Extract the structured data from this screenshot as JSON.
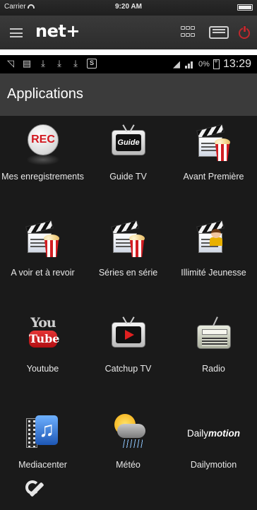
{
  "ios_status": {
    "carrier": "Carrier",
    "time": "9:20 AM"
  },
  "header": {
    "brand": "net+"
  },
  "android_status": {
    "battery_percent": "0%",
    "time": "13:29"
  },
  "screen_title": "Applications",
  "apps": [
    {
      "label": "Mes enregistrements",
      "icon": "rec-icon"
    },
    {
      "label": "Guide TV",
      "icon": "tv-guide-icon"
    },
    {
      "label": "Avant Première",
      "icon": "clapperboard-popcorn-icon"
    },
    {
      "label": "A voir et à revoir",
      "icon": "clapperboard-popcorn-icon"
    },
    {
      "label": "Séries en série",
      "icon": "clapperboard-popcorn-icon"
    },
    {
      "label": "Illimité Jeunesse",
      "icon": "clapperboard-kid-icon"
    },
    {
      "label": "Youtube",
      "icon": "youtube-icon"
    },
    {
      "label": "Catchup TV",
      "icon": "tv-play-icon"
    },
    {
      "label": "Radio",
      "icon": "radio-icon"
    },
    {
      "label": "Mediacenter",
      "icon": "media-music-icon"
    },
    {
      "label": "Météo",
      "icon": "weather-icon"
    },
    {
      "label": "Dailymotion",
      "icon": "dailymotion-logo"
    }
  ],
  "icon_text": {
    "rec": "REC",
    "guide": "Guide",
    "you": "You",
    "tube": "Tube",
    "daily_prefix": "Daily",
    "daily_suffix": "motion"
  },
  "colors": {
    "accent_red": "#c0282d",
    "background": "#1a1a1a",
    "title_bar": "#3b3b3b"
  }
}
